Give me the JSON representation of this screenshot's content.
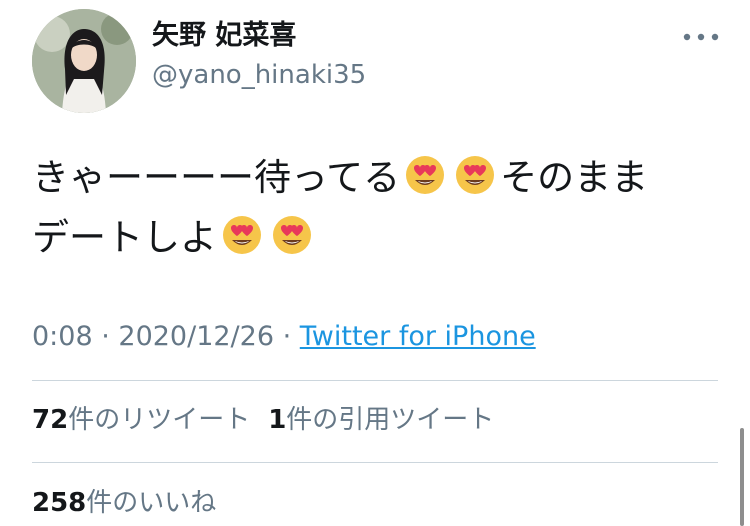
{
  "author": {
    "display_name": "矢野 妃菜喜",
    "handle": "@yano_hinaki35"
  },
  "tweet": {
    "line1_part1": "きゃーーーー待ってる",
    "line1_part2": "そのまま",
    "line2_part1": "デートしよ",
    "emoji_name": "smiling-face-with-heart-eyes"
  },
  "meta": {
    "time": "0:08",
    "separator": " · ",
    "date": "2020/12/26",
    "source": "Twitter for iPhone"
  },
  "stats": {
    "retweets_count": "72",
    "retweets_label": "件のリツイート",
    "quotes_count": "1",
    "quotes_label": "件の引用ツイート",
    "likes_count": "258",
    "likes_label": "件のいいね"
  },
  "colors": {
    "text": "#14171a",
    "muted": "#657786",
    "link": "#1b95e0",
    "divider": "#ccd6dd"
  },
  "icons": [
    "more-icon",
    "avatar"
  ]
}
